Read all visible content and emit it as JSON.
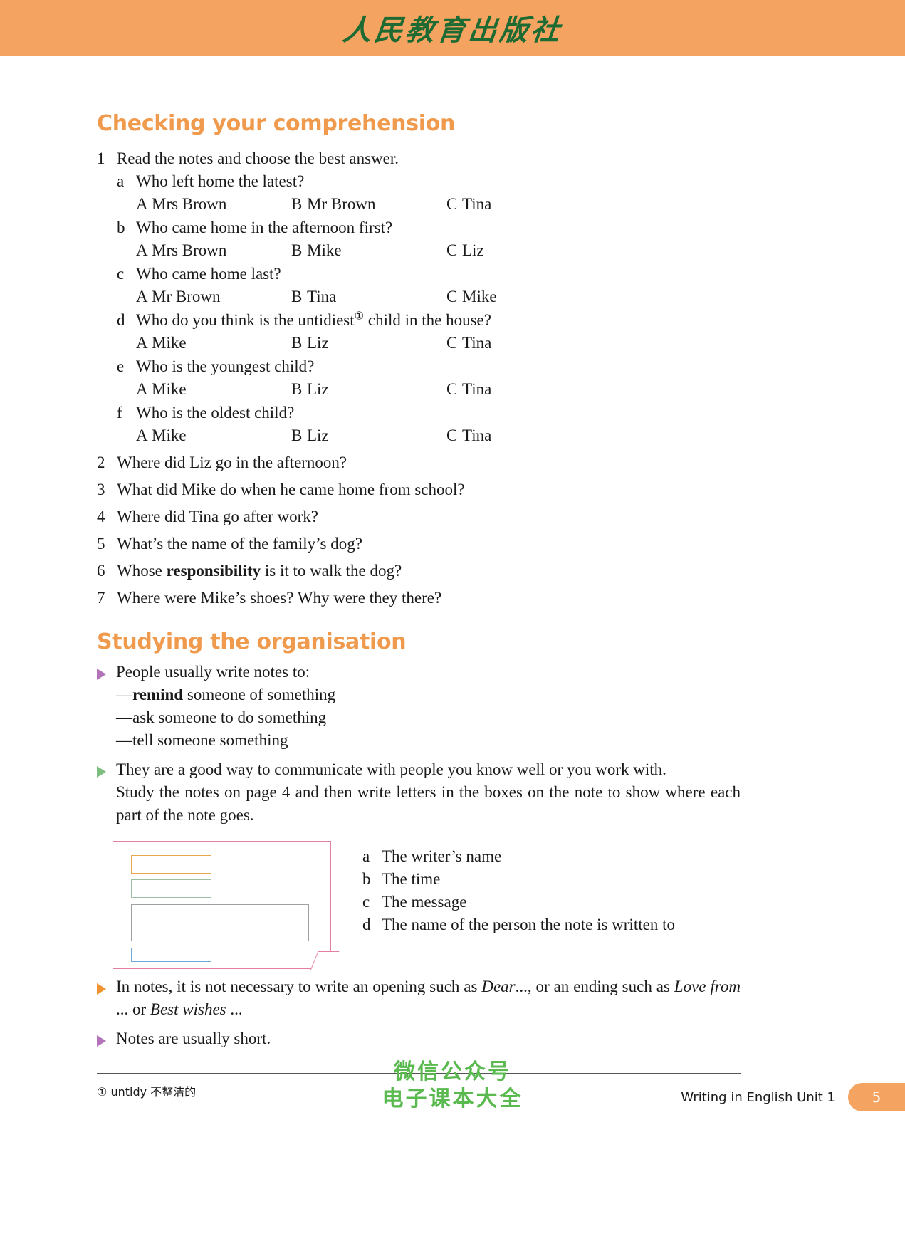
{
  "banner": {
    "publisher_logo_text": "人民教育出版社"
  },
  "sections": {
    "comprehension": {
      "heading": "Checking your comprehension",
      "q1": {
        "number": "1",
        "prompt": "Read the notes and choose the best answer.",
        "items": [
          {
            "letter": "a",
            "question": "Who left home the latest?",
            "options": [
              {
                "key": "A",
                "text": "Mrs Brown"
              },
              {
                "key": "B",
                "text": "Mr Brown"
              },
              {
                "key": "C",
                "text": "Tina"
              }
            ]
          },
          {
            "letter": "b",
            "question": "Who came home in the afternoon first?",
            "options": [
              {
                "key": "A",
                "text": "Mrs Brown"
              },
              {
                "key": "B",
                "text": "Mike"
              },
              {
                "key": "C",
                "text": "Liz"
              }
            ]
          },
          {
            "letter": "c",
            "question": "Who came home last?",
            "options": [
              {
                "key": "A",
                "text": "Mr Brown"
              },
              {
                "key": "B",
                "text": "Tina"
              },
              {
                "key": "C",
                "text": "Mike"
              }
            ]
          },
          {
            "letter": "d",
            "question_prefix": "Who do you think is the untidiest",
            "question_suffix": " child in the house?",
            "footnote_marker": "①",
            "options": [
              {
                "key": "A",
                "text": "Mike"
              },
              {
                "key": "B",
                "text": "Liz"
              },
              {
                "key": "C",
                "text": "Tina"
              }
            ]
          },
          {
            "letter": "e",
            "question": "Who is the youngest child?",
            "options": [
              {
                "key": "A",
                "text": "Mike"
              },
              {
                "key": "B",
                "text": "Liz"
              },
              {
                "key": "C",
                "text": "Tina"
              }
            ]
          },
          {
            "letter": "f",
            "question": "Who is the oldest child?",
            "options": [
              {
                "key": "A",
                "text": "Mike"
              },
              {
                "key": "B",
                "text": "Liz"
              },
              {
                "key": "C",
                "text": "Tina"
              }
            ]
          }
        ]
      },
      "questions": [
        {
          "number": "2",
          "text": "Where did Liz go in the afternoon?"
        },
        {
          "number": "3",
          "text": "What did Mike do when he came home from school?"
        },
        {
          "number": "4",
          "text": "Where did Tina go after work?"
        },
        {
          "number": "5",
          "text": "What’s the name of the family’s dog?"
        },
        {
          "number": "6",
          "text_before": "Whose ",
          "bold": "responsibility",
          "text_after": " is it to walk the dog?"
        },
        {
          "number": "7",
          "text": "Where were Mike’s shoes? Why were they there?"
        }
      ]
    },
    "organisation": {
      "heading": "Studying the organisation",
      "bullet_1": "People usually write notes to:",
      "dashes": [
        {
          "bold": "remind",
          "rest": " someone of something"
        },
        {
          "bold": "",
          "rest": "ask someone to do something"
        },
        {
          "bold": "",
          "rest": "tell someone something"
        }
      ],
      "bullet_2": "They are a good way to communicate with people you know well or you work with.",
      "study_para": "Study the notes on page 4 and then write letters in the boxes on the note to show where each part of the note goes.",
      "note_labels": [
        {
          "key": "a",
          "text": "The writer’s name"
        },
        {
          "key": "b",
          "text": "The time"
        },
        {
          "key": "c",
          "text": "The message"
        },
        {
          "key": "d",
          "text": "The name of the person the note is written to"
        }
      ],
      "bullet_3": {
        "p1": "In notes, it is not necessary to write an opening such as ",
        "i1": "Dear",
        "p2": "..., or an ending such as ",
        "i2": "Love from",
        "p3": " ... or ",
        "i3": "Best wishes",
        "p4": " ..."
      },
      "bullet_4": "Notes are usually short."
    }
  },
  "footnote": {
    "marker": "①",
    "term": "untidy",
    "gloss": "不整洁的"
  },
  "watermark": {
    "line1": "微信公众号",
    "line2": "电子课本大全"
  },
  "footer": {
    "label": "Writing in English Unit 1",
    "page_number": "5"
  },
  "colors": {
    "banner": "#f4a460",
    "heading_orange": "#ef9a4d",
    "bullet_purple": "#b273b8",
    "bullet_green": "#7dbd7f",
    "bullet_orange": "#f0922e",
    "note_border_pink": "#e4809f",
    "note_box_orange": "#eaa84e",
    "note_box_green": "#9fbfa3",
    "note_box_gray": "#a0a0a0",
    "note_box_blue": "#6fa8d8",
    "watermark_green": "#5ab94f"
  }
}
